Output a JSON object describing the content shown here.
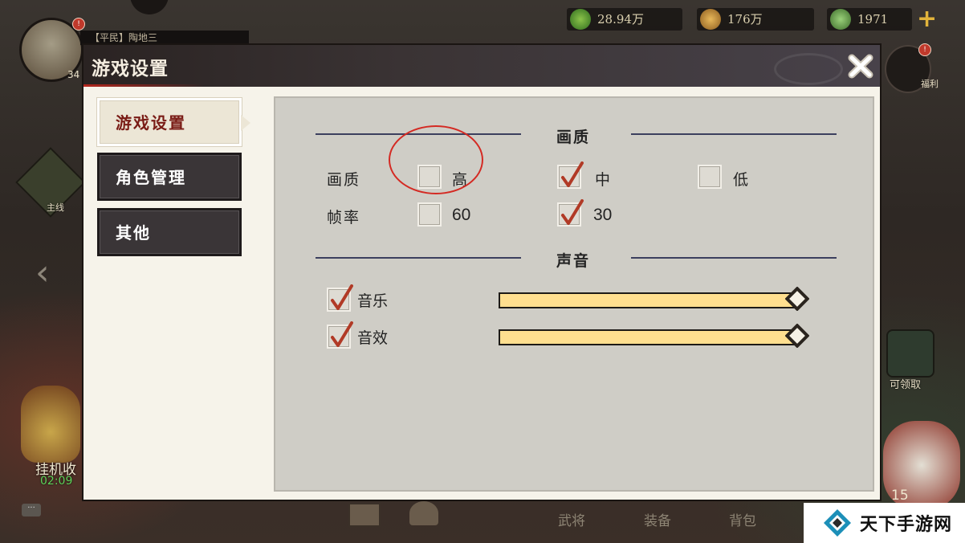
{
  "resources": [
    {
      "icon": "jade-coin-icon",
      "value": "28.94万"
    },
    {
      "icon": "copper-coin-icon",
      "value": "176万"
    },
    {
      "icon": "green-pouch-icon",
      "value": "1971"
    }
  ],
  "background": {
    "avatar_level": "34",
    "player_name_strip": "【平民】陶地三",
    "fuli_label": "福利",
    "main_quest_label": "主线",
    "idle_label": "挂机收",
    "idle_time": "02:09",
    "right_green_label": "可领取",
    "right_number": "15",
    "bottom_nav": [
      "武将",
      "装备",
      "背包"
    ],
    "badge_mark": "!"
  },
  "dialog": {
    "title": "游戏设置",
    "tabs": [
      {
        "label": "游戏设置",
        "active": true
      },
      {
        "label": "角色管理",
        "active": false
      },
      {
        "label": "其他",
        "active": false
      }
    ],
    "quality_section": {
      "title": "画质",
      "row_label": "画质",
      "options": [
        {
          "label": "高",
          "checked": false
        },
        {
          "label": "中",
          "checked": true
        },
        {
          "label": "低",
          "checked": false
        }
      ]
    },
    "framerate": {
      "row_label": "帧率",
      "options": [
        {
          "label": "60",
          "checked": false
        },
        {
          "label": "30",
          "checked": true
        }
      ]
    },
    "sound_section": {
      "title": "声音",
      "music": {
        "label": "音乐",
        "checked": true,
        "level": 1.0
      },
      "sfx": {
        "label": "音效",
        "checked": true,
        "level": 1.0
      }
    }
  },
  "watermark": {
    "text": "天下手游网"
  },
  "colors": {
    "accent_red": "#b3261e",
    "tab_active_text": "#7a1c16",
    "slider_fill": "#ffe39a",
    "annotation_red": "#d42a23",
    "section_line": "#3c3f5e"
  }
}
